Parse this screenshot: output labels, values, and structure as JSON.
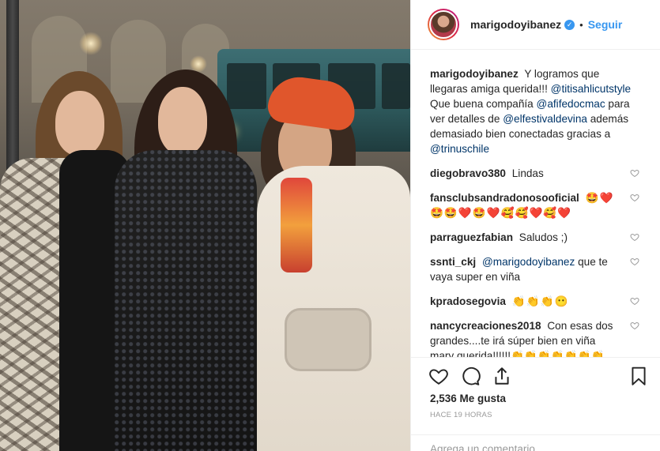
{
  "header": {
    "username": "marigodoyibanez",
    "separator": "•",
    "follow_label": "Seguir"
  },
  "caption": {
    "username": "marigodoyibanez",
    "text_1": " Y logramos que llegaras amiga querida!!! ",
    "mention_1": "@titisahlicutstyle",
    "text_2": " Que buena compañía ",
    "mention_2": "@afifedocmac",
    "text_3": " para ver detalles de ",
    "mention_3": "@elfestivaldevina",
    "text_4": " además demasiado bien conectadas gracias a ",
    "mention_4": "@trinuschile"
  },
  "comments": [
    {
      "username": "diegobravo380",
      "text": "Lindas"
    },
    {
      "username": "fansclubsandradonosooficial",
      "text": "🤩❤️🤩🤩❤️🤩❤️🥰🥰❤️🥰❤️"
    },
    {
      "username": "parraguezfabian",
      "text": "Saludos ;)"
    },
    {
      "username": "ssnti_ckj",
      "mention": "@marigodoyibanez",
      "text": " que te vaya super en viña"
    },
    {
      "username": "kpradosegovia",
      "text": "👏👏👏😶"
    },
    {
      "username": "nancycreaciones2018",
      "text": "Con esas dos grandes....te irá súper bien en viña mary querida!!!!!!👏👏👏👏👏👏👏🙌🙌🙌🙌🙌...saludos desde TALCA 🤩"
    }
  ],
  "likes_text": "2,536 Me gusta",
  "time_text": "HACE 19 HORAS",
  "add_comment_placeholder": "Agrega un comentario...",
  "colors": {
    "link": "#3897f0",
    "mention": "#003569",
    "text": "#262626",
    "muted": "#999999"
  },
  "icons": [
    "verified-icon",
    "heart-icon",
    "comment-icon",
    "share-icon",
    "save-icon",
    "like-comment-icon"
  ]
}
